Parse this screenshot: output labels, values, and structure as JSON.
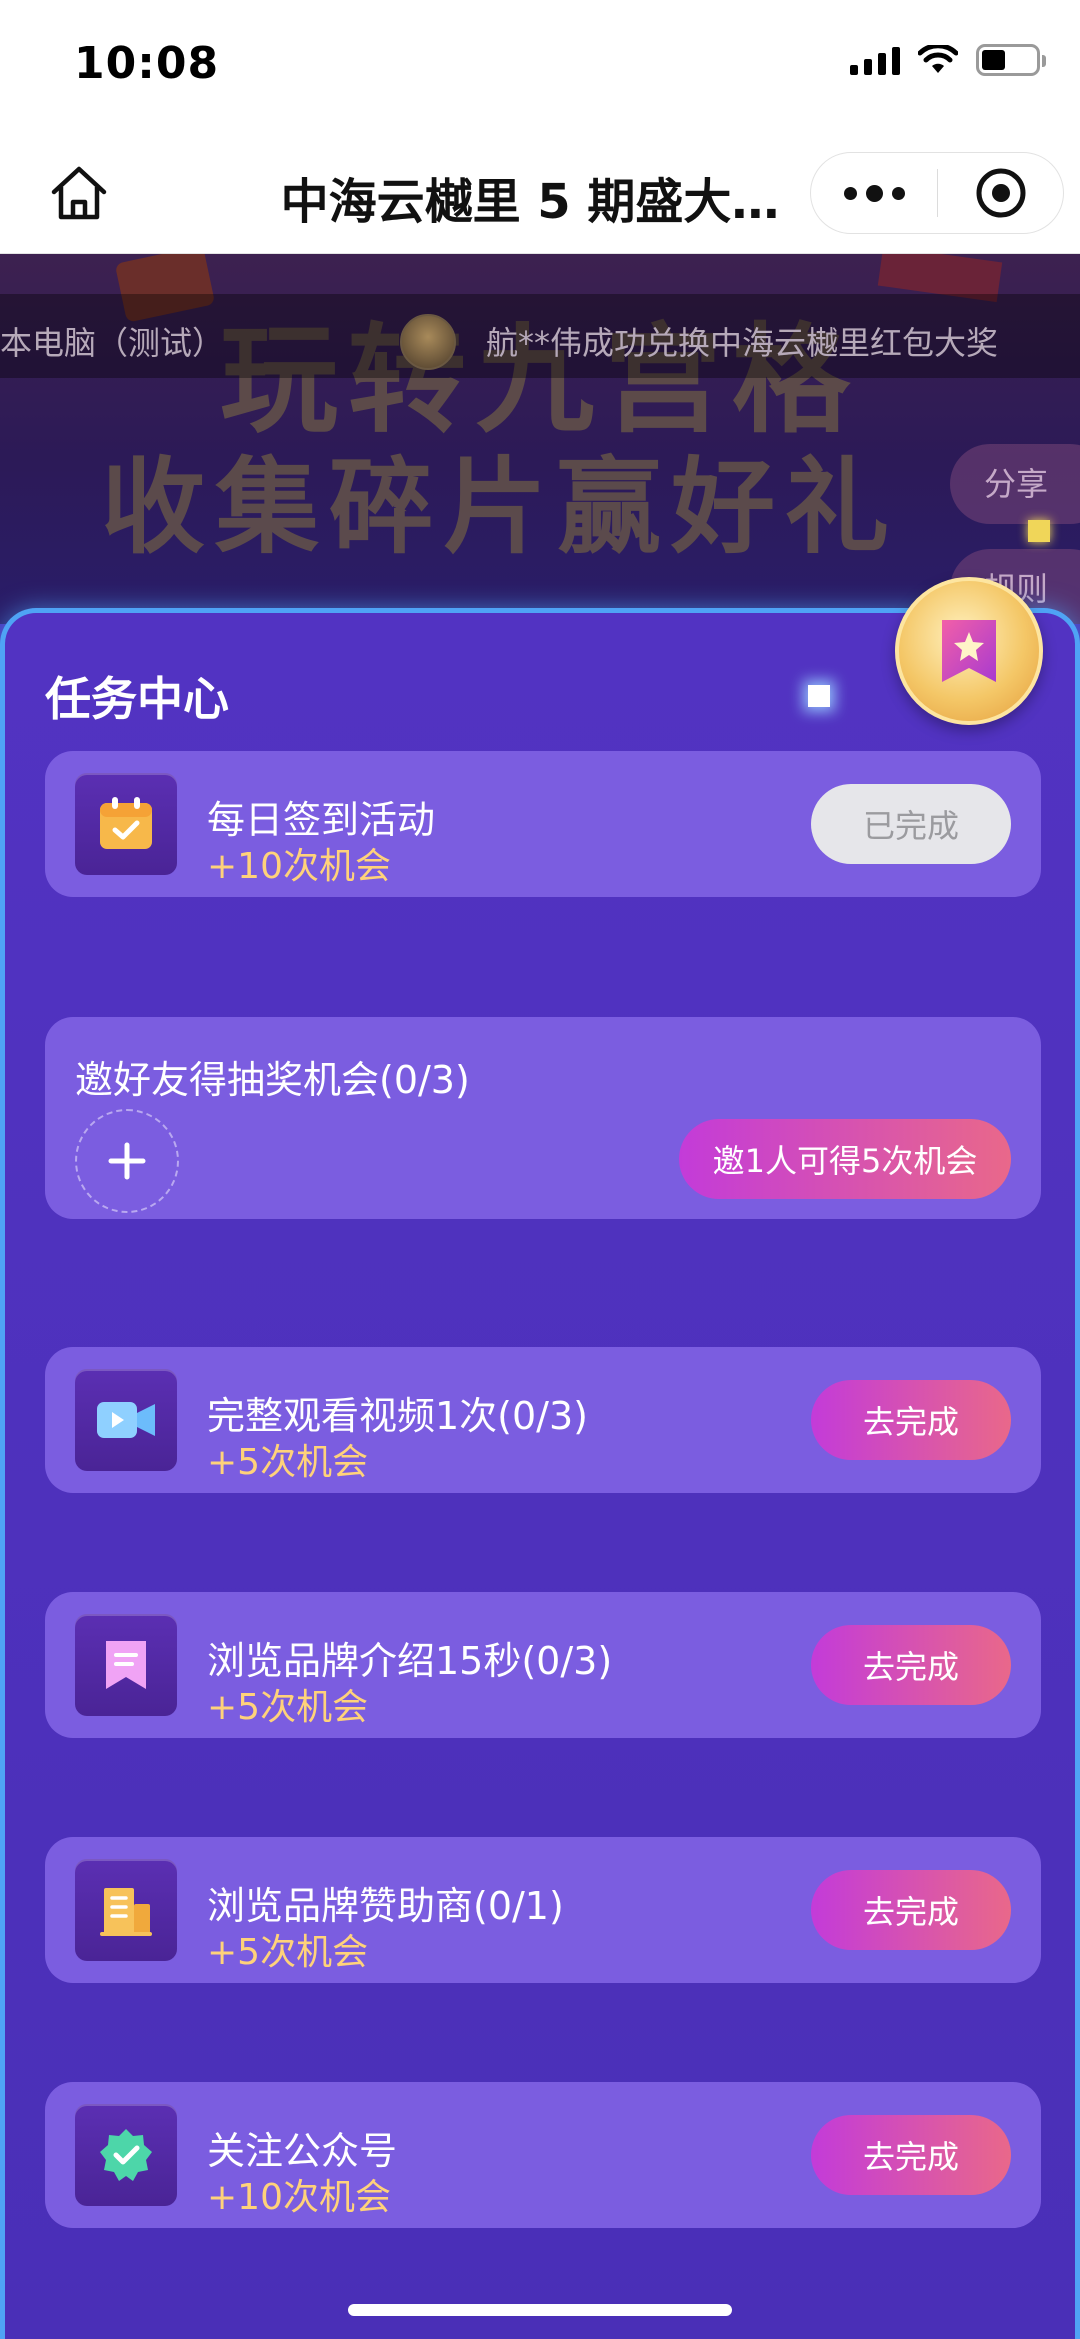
{
  "status_bar": {
    "time": "10:08"
  },
  "nav": {
    "title": "中海云樾里 5 期盛大…"
  },
  "banner": {
    "line1": "玩转九宫格",
    "line2": "收集碎片赢好礼",
    "ticker_left": "本电脑（测试）",
    "ticker_right": "航**伟成功兑换中海云樾里红包大奖",
    "share_label": "分享",
    "rules_label": "规则"
  },
  "task_center": {
    "title": "任务中心",
    "checkin": {
      "name": "每日签到活动",
      "reward": "+10次机会",
      "button": "已完成",
      "status": "done",
      "icon": "calendar-icon"
    },
    "invite": {
      "title": "邀好友得抽奖机会(0/3)",
      "button": "邀1人可得5次机会"
    },
    "tasks": [
      {
        "name": "完整观看视频1次(0/3)",
        "reward": "+5次机会",
        "button": "去完成",
        "icon": "video-icon"
      },
      {
        "name": "浏览品牌介绍15秒(0/3)",
        "reward": "+5次机会",
        "button": "去完成",
        "icon": "bookmark-icon"
      },
      {
        "name": "浏览品牌赞助商(0/1)",
        "reward": "+5次机会",
        "button": "去完成",
        "icon": "building-icon"
      },
      {
        "name": "关注公众号",
        "reward": "+10次机会",
        "button": "去完成",
        "icon": "verified-badge-icon"
      }
    ]
  },
  "colors": {
    "panel_bg": "#4a2fb7",
    "card_bg": "#7b5de0",
    "reward_text": "#ffd27a",
    "button_gradient_start": "#c33bd9",
    "button_gradient_end": "#e9688a",
    "panel_border": "#4fa3f5"
  }
}
